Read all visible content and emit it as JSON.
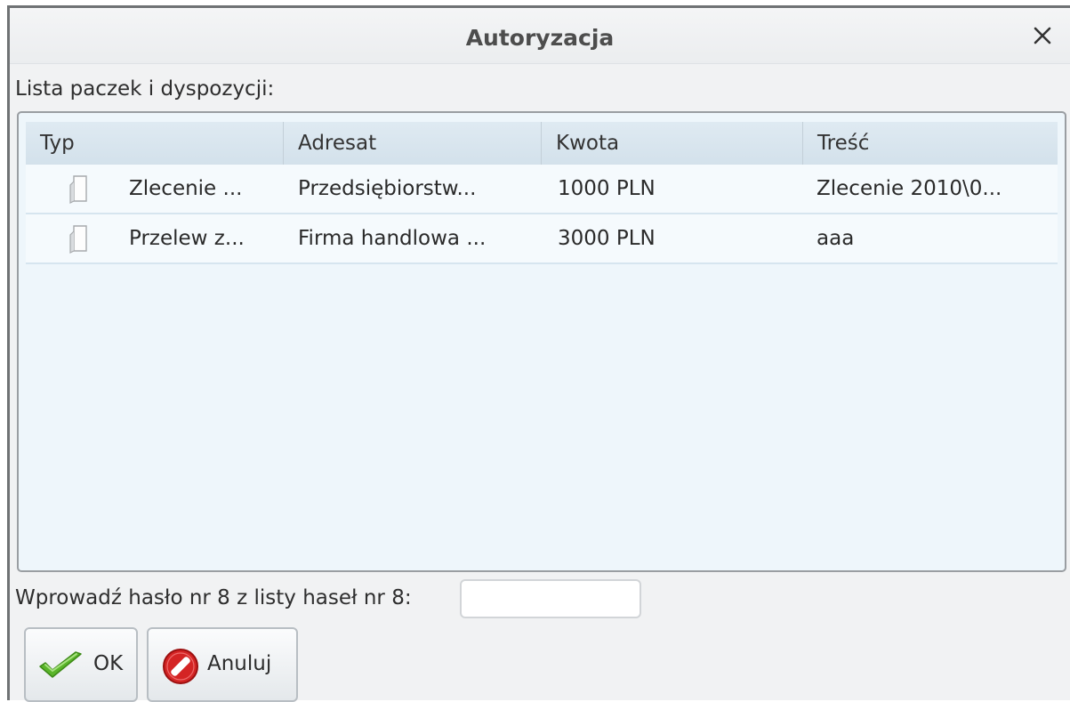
{
  "dialog": {
    "title": "Autoryzacja",
    "close_glyph": "✕"
  },
  "list": {
    "label": "Lista paczek i dyspozycji:",
    "columns": [
      "Typ",
      "Adresat",
      "Kwota",
      "Treść"
    ],
    "rows": [
      {
        "icon": "document-icon",
        "type": "Zlecenie ...",
        "recipient": "Przedsiębiorstw...",
        "amount": "1000 PLN",
        "content": "Zlecenie 2010\\0..."
      },
      {
        "icon": "document-icon",
        "type": "Przelew z...",
        "recipient": "Firma handlowa ...",
        "amount": "3000 PLN",
        "content": "aaa"
      }
    ]
  },
  "password": {
    "prompt": "Wprowadź hasło nr 8 z listy haseł nr 8:",
    "value": "",
    "placeholder": ""
  },
  "buttons": {
    "ok": {
      "label": "OK",
      "icon": "checkmark-icon"
    },
    "cancel": {
      "label": "Anuluj",
      "icon": "no-entry-icon"
    }
  },
  "colors": {
    "accent_green": "#5ab52a",
    "cancel_red": "#d42424"
  }
}
